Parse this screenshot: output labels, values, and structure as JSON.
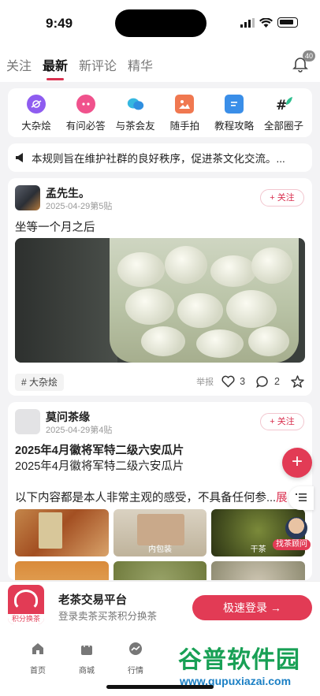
{
  "status_bar": {
    "time": "9:49"
  },
  "header": {
    "tabs": [
      {
        "label": "关注",
        "active": false
      },
      {
        "label": "最新",
        "active": true
      },
      {
        "label": "新评论",
        "active": false
      },
      {
        "label": "精华",
        "active": false
      }
    ],
    "notification_count": "40"
  },
  "categories": [
    {
      "label": "大杂烩",
      "icon": "planet-icon",
      "color": "#8e5cf0"
    },
    {
      "label": "有问必答",
      "icon": "ask-icon",
      "color": "#f0528c"
    },
    {
      "label": "与茶会友",
      "icon": "chat-bubbles-icon",
      "color": "#3aa7e8"
    },
    {
      "label": "随手拍",
      "icon": "photo-icon",
      "color": "#f07850"
    },
    {
      "label": "教程攻略",
      "icon": "guide-icon",
      "color": "#3a8ee8"
    },
    {
      "label": "全部圈子",
      "icon": "hashtag-icon",
      "color": "#2fbf8f"
    }
  ],
  "notice": {
    "text": "本规则旨在维护社群的良好秩序，促进茶文化交流。..."
  },
  "posts": [
    {
      "username": "孟先生。",
      "meta": "2025-04-29第5贴",
      "follow_label": "+ 关注",
      "text": "坐等一个月之后",
      "tag": "#  大杂烩",
      "report_label": "举报",
      "likes": "3",
      "comments": "2"
    },
    {
      "username": "莫问茶缘",
      "meta": "2025-04-29第4贴",
      "follow_label": "+ 关注",
      "title": "2025年4月徽将军特二级六安瓜片",
      "subtitle": "2025年4月徽将军特二级六安瓜片",
      "excerpt": "以下内容都是本人非常主观的感受，不具备任何参...",
      "expand_label": "展",
      "image_captions": [
        "",
        "内包装",
        "干茶"
      ]
    }
  ],
  "floating": {
    "add_label": "+",
    "list_icon": "list-icon",
    "advisor_label": "找茶顾问"
  },
  "promo": {
    "logo_text": "积分换茶",
    "title": "老茶交易平台",
    "subtitle": "登录卖茶买茶积分换茶",
    "button_label": "极速登录  →"
  },
  "bottom_nav": [
    {
      "label": "首页",
      "icon": "home-icon"
    },
    {
      "label": "商城",
      "icon": "shop-bag-icon"
    },
    {
      "label": "行情",
      "icon": "trend-icon"
    }
  ],
  "watermark": {
    "main": "谷普软件园",
    "sub": "www.gupuxiazai.com"
  }
}
